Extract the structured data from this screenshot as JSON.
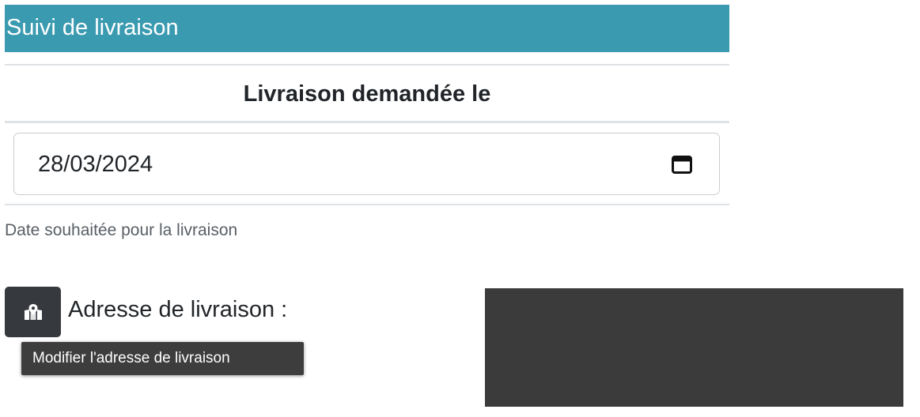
{
  "header": {
    "title": "Suivi de livraison",
    "color": "#3a9ab0"
  },
  "section": {
    "title": "Livraison demandée le"
  },
  "date_field": {
    "value": "28/03/2024",
    "icon": "calendar-icon"
  },
  "help": {
    "text": "Date souhaitée pour la livraison"
  },
  "address": {
    "label": "Adresse de livraison :",
    "button_icon": "map-marker-icon",
    "tooltip": "Modifier l'adresse de livraison"
  }
}
